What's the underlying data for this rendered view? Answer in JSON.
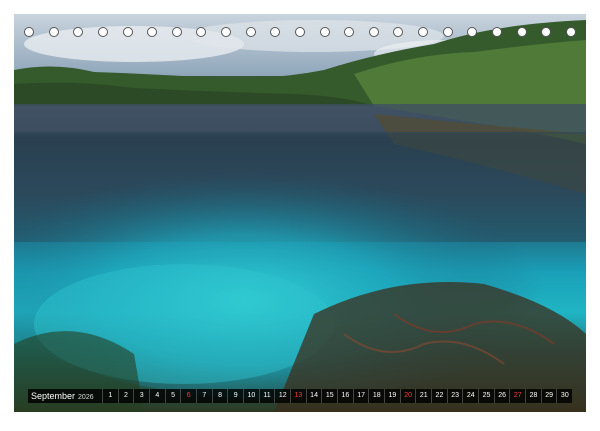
{
  "calendar": {
    "month": "September",
    "year": "2026",
    "days": [
      {
        "n": "1",
        "sun": false
      },
      {
        "n": "2",
        "sun": false
      },
      {
        "n": "3",
        "sun": false
      },
      {
        "n": "4",
        "sun": false
      },
      {
        "n": "5",
        "sun": false
      },
      {
        "n": "6",
        "sun": true
      },
      {
        "n": "7",
        "sun": false
      },
      {
        "n": "8",
        "sun": false
      },
      {
        "n": "9",
        "sun": false
      },
      {
        "n": "10",
        "sun": false
      },
      {
        "n": "11",
        "sun": false
      },
      {
        "n": "12",
        "sun": false
      },
      {
        "n": "13",
        "sun": true
      },
      {
        "n": "14",
        "sun": false
      },
      {
        "n": "15",
        "sun": false
      },
      {
        "n": "16",
        "sun": false
      },
      {
        "n": "17",
        "sun": false
      },
      {
        "n": "18",
        "sun": false
      },
      {
        "n": "19",
        "sun": false
      },
      {
        "n": "20",
        "sun": true
      },
      {
        "n": "21",
        "sun": false
      },
      {
        "n": "22",
        "sun": false
      },
      {
        "n": "23",
        "sun": false
      },
      {
        "n": "24",
        "sun": false
      },
      {
        "n": "25",
        "sun": false
      },
      {
        "n": "26",
        "sun": false
      },
      {
        "n": "27",
        "sun": true
      },
      {
        "n": "28",
        "sun": false
      },
      {
        "n": "29",
        "sun": false
      },
      {
        "n": "30",
        "sun": false
      }
    ]
  },
  "binding_rings": 23,
  "colors": {
    "strip_bg": "#000000",
    "sunday": "#ff3b3b",
    "text": "#ffffff"
  }
}
